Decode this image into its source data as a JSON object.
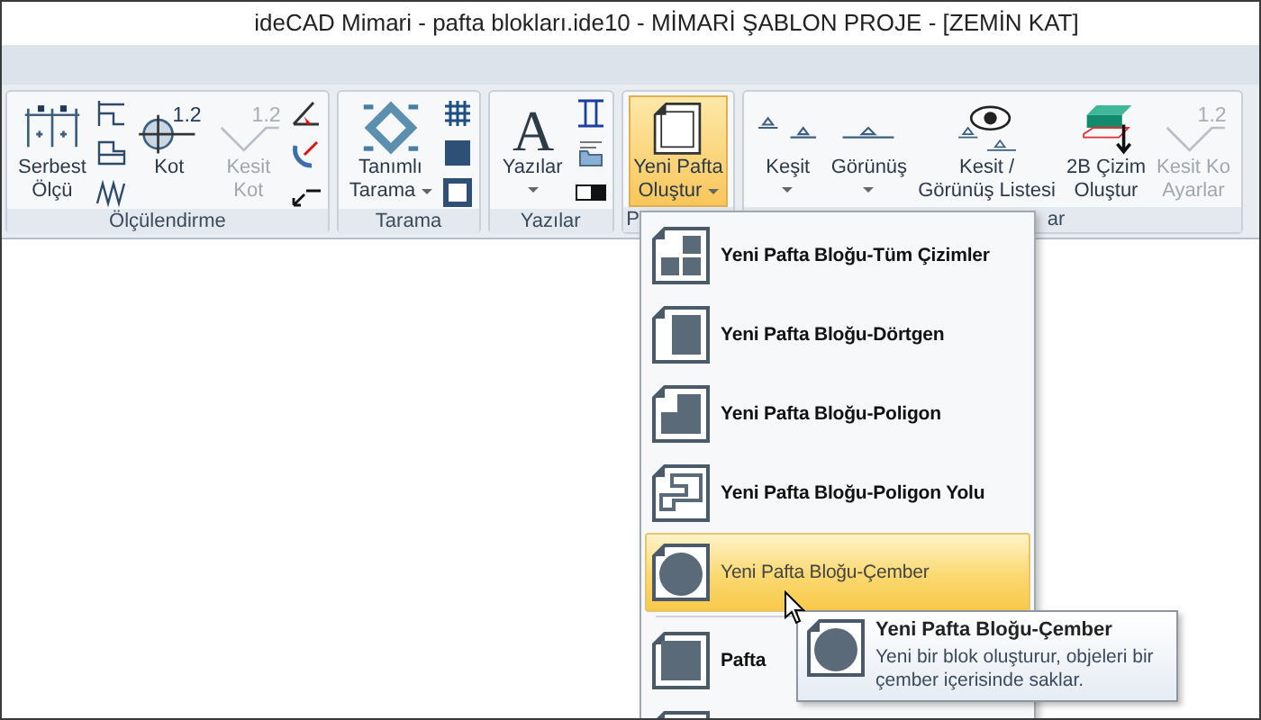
{
  "window": {
    "title": "ideCAD Mimari - pafta blokları.ide10 - MİMARİ ŞABLON PROJE - [ZEMİN KAT]"
  },
  "ribbon": {
    "groups": [
      {
        "label": "Ölçülendirme",
        "items": [
          {
            "kind": "large",
            "lines": [
              "Serbest",
              "Ölçü"
            ],
            "disabled": false,
            "dropdown": false,
            "selected": false
          },
          {
            "kind": "small_column"
          },
          {
            "kind": "large",
            "lines": [
              "Kot"
            ],
            "icon_text": "1.2",
            "disabled": false,
            "dropdown": false,
            "selected": false
          },
          {
            "kind": "large",
            "lines": [
              "Kesit",
              "Kot"
            ],
            "icon_text": "1.2",
            "disabled": true,
            "dropdown": false,
            "selected": false
          },
          {
            "kind": "small_column"
          }
        ]
      },
      {
        "label": "Tarama",
        "items": [
          {
            "kind": "large",
            "lines": [
              "Tanımlı",
              "Tarama"
            ],
            "disabled": false,
            "dropdown": true,
            "selected": false
          },
          {
            "kind": "small_column"
          }
        ]
      },
      {
        "label": "Yazılar",
        "items": [
          {
            "kind": "large",
            "lines": [
              "Yazılar"
            ],
            "icon_text": "A",
            "disabled": false,
            "dropdown": true,
            "selected": false
          },
          {
            "kind": "small_column"
          }
        ]
      },
      {
        "label": "P",
        "items": [
          {
            "kind": "large",
            "lines": [
              "Yeni Pafta",
              "Oluştur"
            ],
            "disabled": false,
            "dropdown": true,
            "selected": true
          }
        ]
      },
      {
        "label": "ar",
        "items": [
          {
            "kind": "large",
            "lines": [
              "Keşit"
            ],
            "disabled": false,
            "dropdown": true,
            "selected": false
          },
          {
            "kind": "large",
            "lines": [
              "Görünüş"
            ],
            "disabled": false,
            "dropdown": true,
            "selected": false
          },
          {
            "kind": "large",
            "lines": [
              "Kesit /",
              "Görünüş Listesi"
            ],
            "disabled": false,
            "dropdown": false,
            "selected": false
          },
          {
            "kind": "large",
            "lines": [
              "2B Çizim",
              "Oluştur"
            ],
            "disabled": false,
            "dropdown": false,
            "selected": false
          },
          {
            "kind": "large",
            "lines": [
              "Kesit Ko",
              "Ayarlar"
            ],
            "icon_text": "1.2",
            "disabled": true,
            "dropdown": false,
            "selected": false
          }
        ]
      }
    ]
  },
  "menu": {
    "items": [
      {
        "kind": "item",
        "label": "Yeni Pafta Bloğu-Tüm Çizimler",
        "selected": false
      },
      {
        "kind": "item",
        "label": "Yeni Pafta Bloğu-Dörtgen",
        "selected": false
      },
      {
        "kind": "item",
        "label": "Yeni Pafta Bloğu-Poligon",
        "selected": false
      },
      {
        "kind": "item",
        "label": "Yeni Pafta Bloğu-Poligon Yolu",
        "selected": false
      },
      {
        "kind": "item",
        "label": "Yeni Pafta Bloğu-Çember",
        "selected": true
      },
      {
        "kind": "separator"
      },
      {
        "kind": "item",
        "label": "Pafta",
        "selected": false
      },
      {
        "kind": "icon_only"
      }
    ]
  },
  "tooltip": {
    "title": "Yeni Pafta Bloğu-Çember",
    "description": "Yeni bir blok oluşturur, objeleri bir çember içerisinde saklar."
  }
}
